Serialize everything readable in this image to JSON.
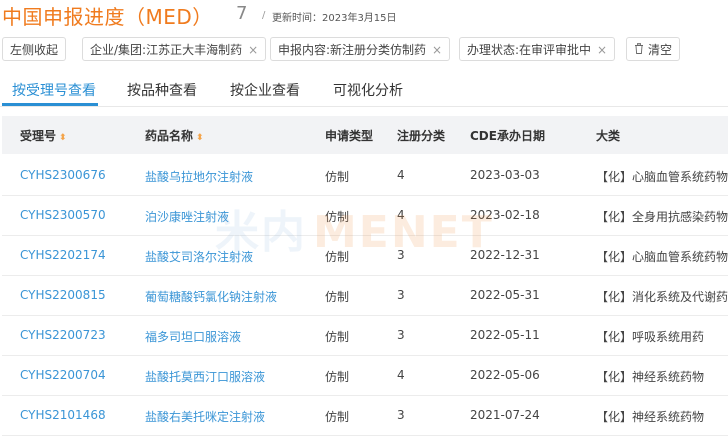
{
  "header": {
    "title": "中国申报进度（MED）",
    "count": "7",
    "separator": "/",
    "update_label": "更新时间：",
    "update_date": "2023年3月15日"
  },
  "filters": {
    "collapse_label": "左侧收起",
    "chips": [
      {
        "label": "企业/集团:江苏正大丰海制药"
      },
      {
        "label": "申报内容:新注册分类仿制药"
      },
      {
        "label": "办理状态:在审评审批中"
      }
    ],
    "close_glyph": "×",
    "clear_label": "清空"
  },
  "tabs": [
    {
      "label": "按受理号查看",
      "active": true
    },
    {
      "label": "按品种查看",
      "active": false
    },
    {
      "label": "按企业查看",
      "active": false
    },
    {
      "label": "可视化分析",
      "active": false
    }
  ],
  "table": {
    "headers": {
      "accept_no": "受理号",
      "drug_name": "药品名称",
      "apply_type": "申请类型",
      "reg_class": "注册分类",
      "cde_date": "CDE承办日期",
      "category": "大类"
    },
    "sort_glyph": "⬍",
    "rows": [
      {
        "accept_no": "CYHS2300676",
        "drug_name": "盐酸乌拉地尔注射液",
        "apply_type": "仿制",
        "reg_class": "4",
        "cde_date": "2023-03-03",
        "category": "【化】心脑血管系统药物"
      },
      {
        "accept_no": "CYHS2300570",
        "drug_name": "泊沙康唑注射液",
        "apply_type": "仿制",
        "reg_class": "4",
        "cde_date": "2023-02-18",
        "category": "【化】全身用抗感染药物"
      },
      {
        "accept_no": "CYHS2202174",
        "drug_name": "盐酸艾司洛尔注射液",
        "apply_type": "仿制",
        "reg_class": "3",
        "cde_date": "2022-12-31",
        "category": "【化】心脑血管系统药物"
      },
      {
        "accept_no": "CYHS2200815",
        "drug_name": "葡萄糖酸钙氯化钠注射液",
        "apply_type": "仿制",
        "reg_class": "3",
        "cde_date": "2022-05-31",
        "category": "【化】消化系统及代谢药"
      },
      {
        "accept_no": "CYHS2200723",
        "drug_name": "福多司坦口服溶液",
        "apply_type": "仿制",
        "reg_class": "3",
        "cde_date": "2022-05-11",
        "category": "【化】呼吸系统用药"
      },
      {
        "accept_no": "CYHS2200704",
        "drug_name": "盐酸托莫西汀口服溶液",
        "apply_type": "仿制",
        "reg_class": "4",
        "cde_date": "2022-05-06",
        "category": "【化】神经系统药物"
      },
      {
        "accept_no": "CYHS2101468",
        "drug_name": "盐酸右美托咪定注射液",
        "apply_type": "仿制",
        "reg_class": "3",
        "cde_date": "2021-07-24",
        "category": "【化】神经系统药物"
      }
    ]
  },
  "watermark": {
    "part1": "米内",
    "part2": "MENET"
  }
}
